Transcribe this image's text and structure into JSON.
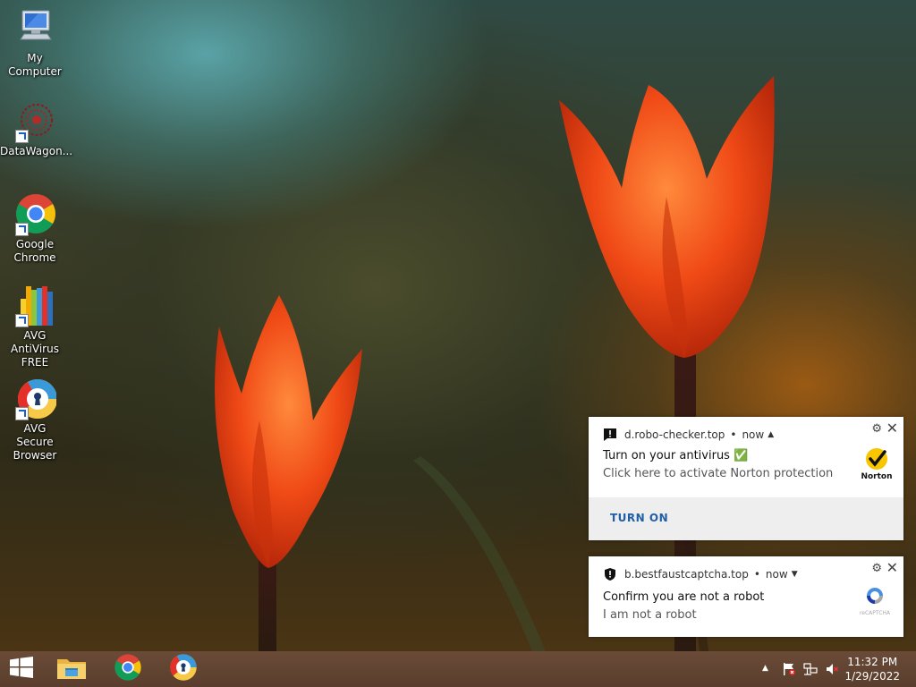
{
  "desktop": {
    "icons": [
      {
        "label": "My Computer"
      },
      {
        "label": "DataWagon..."
      },
      {
        "label": "Google Chrome"
      },
      {
        "label": "AVG AntiVirus FREE"
      },
      {
        "label": "AVG Secure Browser"
      }
    ]
  },
  "notifications": [
    {
      "site": "d.robo-checker.top",
      "time": "now",
      "title": "Turn on your antivirus ✅",
      "body": "Click here to activate Norton protection",
      "image": "norton-logo",
      "image_text": "Norton",
      "action": "TURN ON",
      "settings_icon": "gear-icon",
      "close_icon": "close-icon"
    },
    {
      "site": "b.bestfaustcaptcha.top",
      "time": "now",
      "title": "Confirm you are not a robot",
      "body": "I am not a robot",
      "image": "recaptcha-logo",
      "image_text": "reCAPTCHA",
      "settings_icon": "gear-icon",
      "close_icon": "close-icon"
    }
  ],
  "taskbar": {
    "start_icon": "windows-logo-icon",
    "pinned": [
      "file-explorer-icon",
      "chrome-icon",
      "avg-secure-browser-icon"
    ],
    "tray": {
      "show_hidden_icon": "chevron-up-icon",
      "icons": [
        "action-center-flag-icon",
        "network-icon",
        "volume-muted-icon"
      ]
    },
    "clock": {
      "time": "11:32 PM",
      "date": "1/29/2022"
    }
  },
  "colors": {
    "taskbar": "#5e4030",
    "action_link": "#1f5fa8",
    "chrome_red": "#db4437",
    "chrome_yellow": "#f4c20d",
    "chrome_green": "#0f9d58",
    "chrome_blue": "#4285f4"
  }
}
